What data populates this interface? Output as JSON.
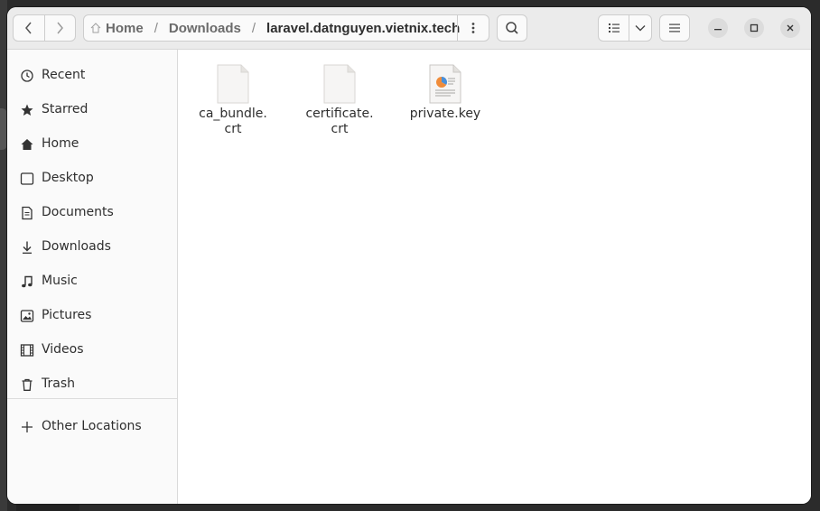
{
  "window": {
    "pathbar": {
      "crumbs": [
        "Home",
        "Downloads",
        "laravel.datnguyen.vietnix.tech"
      ],
      "separator": "/"
    },
    "icons": {
      "back": "chevron-left-icon",
      "forward": "chevron-right-icon",
      "home_crumb": "home-icon",
      "path_menu": "vertical-dots-icon",
      "search": "search-icon",
      "list_view": "list-view-icon",
      "view_options": "chevron-down-icon",
      "main_menu": "hamburger-menu-icon",
      "minimize": "minimize-icon",
      "maximize": "maximize-icon",
      "close": "close-icon"
    }
  },
  "sidebar": {
    "items": [
      {
        "label": "Recent",
        "icon": "clock-icon"
      },
      {
        "label": "Starred",
        "icon": "star-icon"
      },
      {
        "label": "Home",
        "icon": "home-icon"
      },
      {
        "label": "Desktop",
        "icon": "desktop-icon"
      },
      {
        "label": "Documents",
        "icon": "document-icon"
      },
      {
        "label": "Downloads",
        "icon": "download-icon"
      },
      {
        "label": "Music",
        "icon": "music-icon"
      },
      {
        "label": "Pictures",
        "icon": "picture-icon"
      },
      {
        "label": "Videos",
        "icon": "film-icon"
      },
      {
        "label": "Trash",
        "icon": "trash-icon"
      }
    ],
    "other": {
      "label": "Other Locations",
      "icon": "plus-icon"
    }
  },
  "files": [
    {
      "name": "ca_bundle.\ncrt",
      "icon": "blank-file-icon"
    },
    {
      "name": "certificate.\ncrt",
      "icon": "blank-file-icon"
    },
    {
      "name": "private.key",
      "icon": "key-file-icon"
    }
  ],
  "colors": {
    "accent_orange": "#f08c3a",
    "accent_blue": "#4a90d9"
  }
}
